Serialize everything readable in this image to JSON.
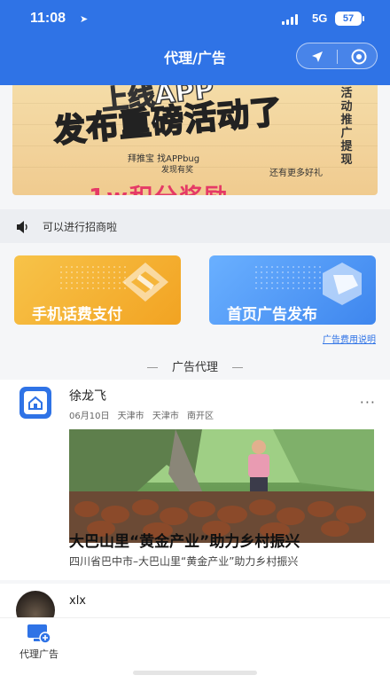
{
  "status_bar": {
    "time": "11:08",
    "network": "5G",
    "battery": "57"
  },
  "header": {
    "title": "代理/广告"
  },
  "banner": {
    "line_top": "上线APP",
    "line_main": "发布重磅活动了",
    "sub1": "拜推宝 找APPbug",
    "sub2": "发现有奖",
    "side_text": [
      "活",
      "动",
      "推",
      "广",
      "提",
      "现"
    ],
    "right_text": "还有更多好礼",
    "bottom_text": "1w积分奖励"
  },
  "notice": {
    "text": "可以进行招商啦"
  },
  "cards": [
    {
      "label": "手机话费支付",
      "color": "#f4b232"
    },
    {
      "label": "首页广告发布",
      "color": "#4d93f2"
    }
  ],
  "fee_link": "广告费用说明",
  "section": {
    "title": "广告代理"
  },
  "post": {
    "author": "徐龙飞",
    "date": "06月10日",
    "locations": [
      "天津市",
      "天津市",
      "南开区"
    ],
    "more": "···",
    "headline": "大巴山里“黄金产业”助力乡村振兴",
    "description": "四川省巴中市–大巴山里“黄金产业”助力乡村振兴"
  },
  "post2": {
    "author": "xlx"
  },
  "tabbar": {
    "items": [
      {
        "label": "代理广告",
        "icon": "monitor-plus-icon"
      }
    ]
  },
  "colors": {
    "primary": "#2f73e6",
    "yellow_card": "#f4b232",
    "blue_card": "#4d93f2"
  }
}
